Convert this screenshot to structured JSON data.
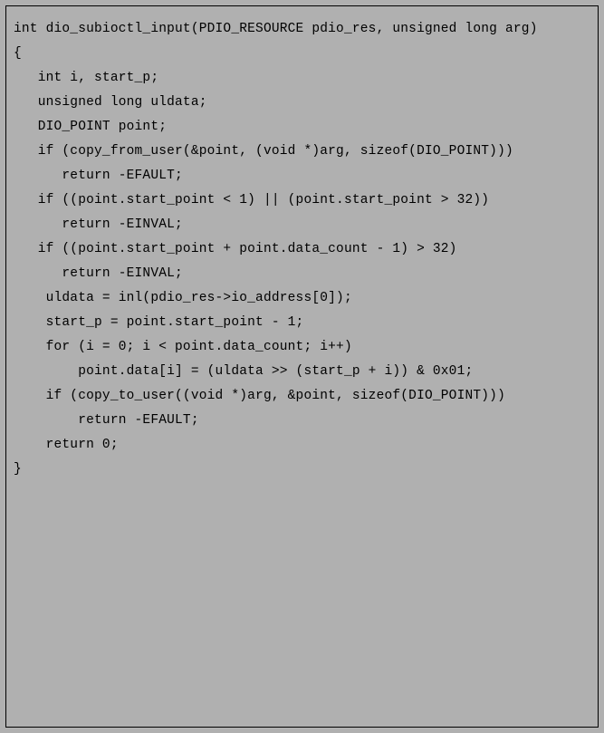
{
  "code": {
    "lines": [
      "int dio_subioctl_input(PDIO_RESOURCE pdio_res, unsigned long arg)",
      "{",
      "   int i, start_p;",
      "   unsigned long uldata;",
      "   DIO_POINT point;",
      "",
      "   if (copy_from_user(&point, (void *)arg, sizeof(DIO_POINT)))",
      "      return -EFAULT;",
      "",
      "   if ((point.start_point < 1) || (point.start_point > 32))",
      "      return -EINVAL;",
      "   if ((point.start_point + point.data_count - 1) > 32)",
      "      return -EINVAL;",
      "",
      "    uldata = inl(pdio_res->io_address[0]);",
      "",
      "    start_p = point.start_point - 1;",
      "",
      "    for (i = 0; i < point.data_count; i++)",
      "        point.data[i] = (uldata >> (start_p + i)) & 0x01;",
      "",
      "    if (copy_to_user((void *)arg, &point, sizeof(DIO_POINT)))",
      "        return -EFAULT;",
      "",
      "    return 0;",
      "}"
    ]
  }
}
